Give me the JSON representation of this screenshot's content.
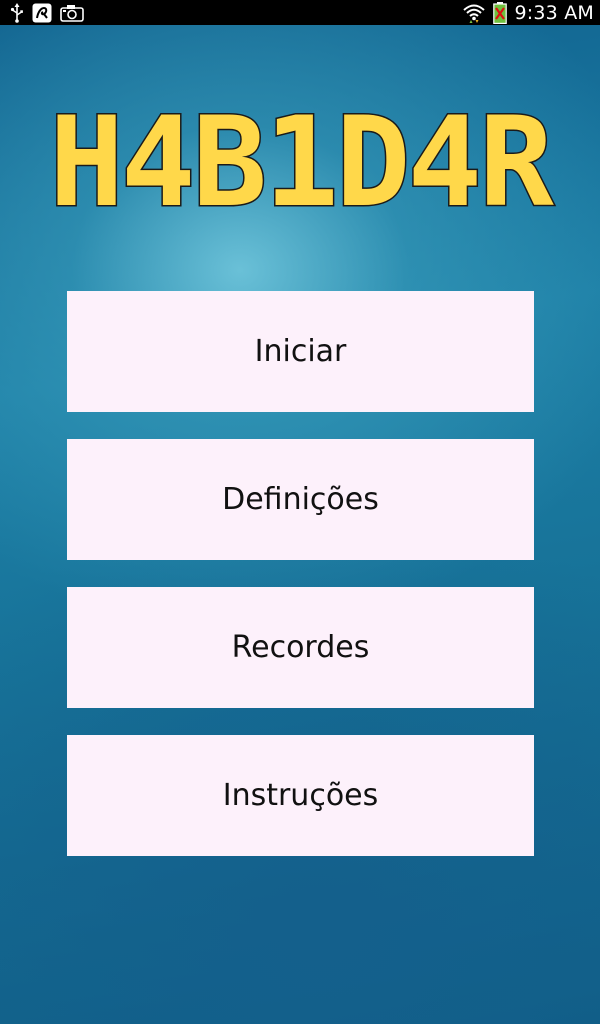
{
  "status_bar": {
    "icons_left": [
      "usb-icon",
      "avast-icon",
      "camera-icon"
    ],
    "icons_right": [
      "wifi-icon",
      "battery-icon"
    ],
    "time": "9:33 AM"
  },
  "app": {
    "title": "H4B1D4R",
    "logo_color": "#ffd84a"
  },
  "menu": {
    "items": [
      {
        "label": "Iniciar"
      },
      {
        "label": "Definições"
      },
      {
        "label": "Recordes"
      },
      {
        "label": "Instruções"
      }
    ]
  }
}
